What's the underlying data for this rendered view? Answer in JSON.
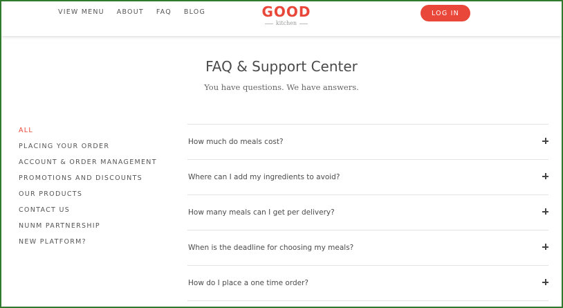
{
  "header": {
    "nav": [
      "VIEW MENU",
      "ABOUT",
      "FAQ",
      "BLOG"
    ],
    "logo_main": "GOOD",
    "logo_sub": "kitchen",
    "login_label": "LOG IN"
  },
  "main": {
    "title": "FAQ & Support Center",
    "subtitle": "You have questions. We have answers."
  },
  "sidebar": {
    "items": [
      {
        "label": "ALL",
        "active": true
      },
      {
        "label": "PLACING YOUR ORDER",
        "active": false
      },
      {
        "label": "ACCOUNT & ORDER MANAGEMENT",
        "active": false
      },
      {
        "label": "PROMOTIONS AND DISCOUNTS",
        "active": false
      },
      {
        "label": "OUR PRODUCTS",
        "active": false
      },
      {
        "label": "CONTACT US",
        "active": false
      },
      {
        "label": "NUNM PARTNERSHIP",
        "active": false
      },
      {
        "label": "NEW PLATFORM?",
        "active": false
      }
    ]
  },
  "faq": {
    "questions": [
      "How much do meals cost?",
      "Where can I add my ingredients to avoid?",
      "How many meals can I get per delivery?",
      "When is the deadline for choosing my meals?",
      "How do I place a one time order?"
    ],
    "expand_icon": "plus-icon"
  },
  "colors": {
    "accent": "#e8473a",
    "text": "#4a4a4a",
    "frame": "#2f7a2f"
  }
}
